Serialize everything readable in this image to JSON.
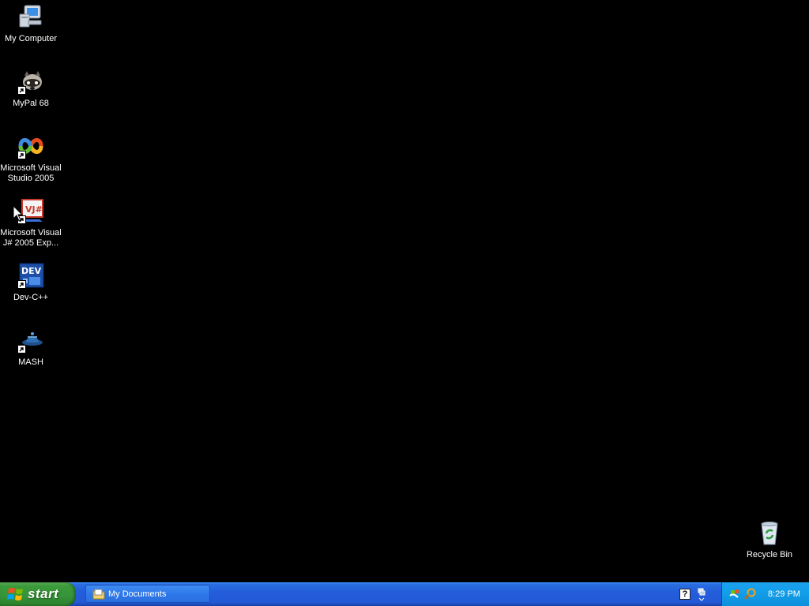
{
  "desktop": {
    "icons": [
      {
        "label": "My Computer",
        "icon": "my-computer-icon",
        "shortcut": false
      },
      {
        "label": "MyPal 68",
        "icon": "mypal-raccoon-icon",
        "shortcut": true
      },
      {
        "label": "Microsoft Visual\nStudio 2005",
        "icon": "visual-studio-icon",
        "shortcut": true
      },
      {
        "label": "Microsoft Visual\nJ# 2005 Exp...",
        "icon": "visual-jsharp-icon",
        "shortcut": true
      },
      {
        "label": "Dev-C++",
        "icon": "dev-cpp-icon",
        "shortcut": true
      },
      {
        "label": "MASH",
        "icon": "mash-hat-icon",
        "shortcut": true
      }
    ],
    "recycle_bin": {
      "label": "Recycle Bin",
      "icon": "recycle-bin-icon"
    }
  },
  "taskbar": {
    "start_label": "start",
    "tasks": [
      {
        "label": "My Documents",
        "icon": "folder-icon"
      }
    ],
    "tray": {
      "icons": [
        "windows-update-icon",
        "search-magnifier-icon"
      ],
      "clock": "8:29 PM"
    }
  },
  "colors": {
    "desktop_bg": "#000000",
    "taskbar_blue": "#245edb",
    "start_green": "#3c9a3a",
    "tray_blue": "#129fe9"
  }
}
